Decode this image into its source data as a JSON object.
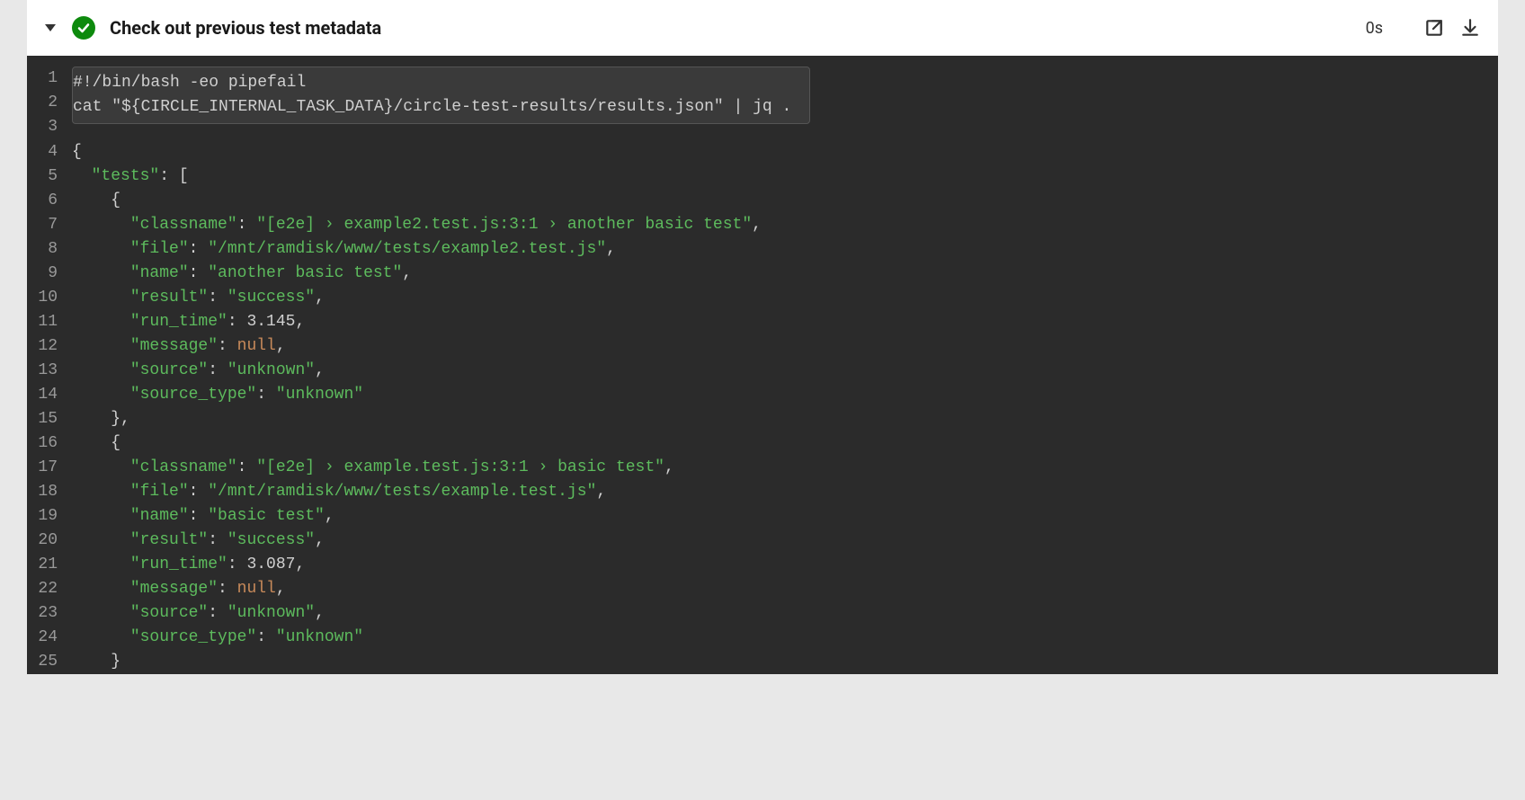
{
  "step": {
    "title": "Check out previous test metadata",
    "duration": "0s"
  },
  "command": {
    "lines": [
      "#!/bin/bash -eo pipefail",
      "cat \"${CIRCLE_INTERNAL_TASK_DATA}/circle-test-results/results.json\" | jq ."
    ]
  },
  "output": {
    "startLine": 4,
    "tests": [
      {
        "classname": "[e2e] › example2.test.js:3:1 › another basic test",
        "file": "/mnt/ramdisk/www/tests/example2.test.js",
        "name": "another basic test",
        "result": "success",
        "run_time": 3.145,
        "message": null,
        "source": "unknown",
        "source_type": "unknown"
      },
      {
        "classname": "[e2e] › example.test.js:3:1 › basic test",
        "file": "/mnt/ramdisk/www/tests/example.test.js",
        "name": "basic test",
        "result": "success",
        "run_time": 3.087,
        "message": null,
        "source": "unknown",
        "source_type": "unknown"
      }
    ]
  }
}
